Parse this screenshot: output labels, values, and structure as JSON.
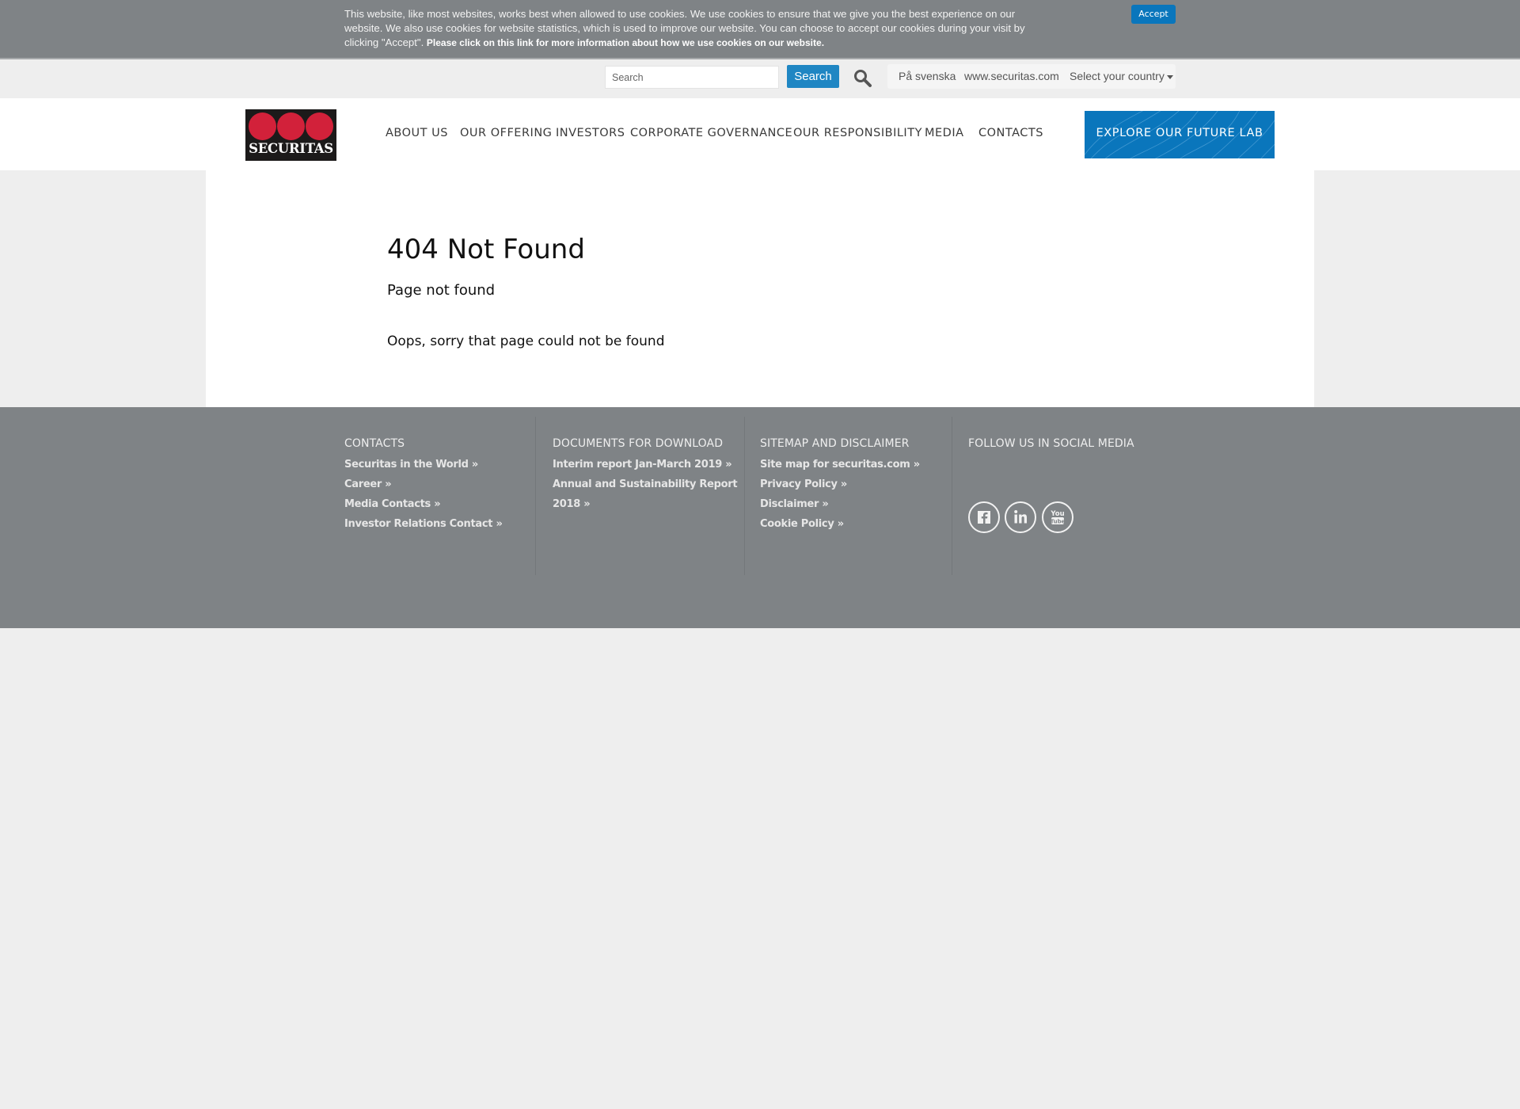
{
  "cookie_bar": {
    "text": "This website, like most websites, works best when allowed to use cookies. We use cookies to ensure that we give you the best experience on our website. We also use cookies for website statistics, which is used to improve our website. You can choose to accept our cookies during your visit by clicking \"Accept\".",
    "more_link": "Please click on this link for more information about how we use cookies on our website.",
    "accept_label": "Accept"
  },
  "utility": {
    "search_placeholder": "Search",
    "search_value": "",
    "search_button": "Search",
    "search_icon": "magnifier-icon",
    "language_link": "På svenska",
    "global_site_link": "www.securitas.com",
    "country_select": "Select your country"
  },
  "header": {
    "logo_text": "SECURITAS",
    "nav": [
      {
        "label": "ABOUT US"
      },
      {
        "label": "OUR OFFERING"
      },
      {
        "label": "INVESTORS"
      },
      {
        "label": "CORPORATE GOVERNANCE"
      },
      {
        "label": "OUR RESPONSIBILITY"
      },
      {
        "label": "MEDIA"
      },
      {
        "label": "CONTACTS"
      }
    ],
    "cta_label": "EXPLORE OUR FUTURE LAB"
  },
  "main": {
    "title": "404 Not Found",
    "subtitle": "Page not found",
    "message": "Oops, sorry that page could not be found"
  },
  "footer": {
    "columns": [
      {
        "heading": "CONTACTS",
        "links": [
          "Securitas in the World »",
          "Career »",
          "Media Contacts »",
          "Investor Relations Contact »"
        ]
      },
      {
        "heading": "DOCUMENTS FOR DOWNLOAD",
        "links": [
          "Interim report Jan-March 2019 »",
          "Annual and Sustainability Report 2018 »"
        ]
      },
      {
        "heading": "SITEMAP AND DISCLAIMER",
        "links": [
          "Site map for securitas.com »",
          "Privacy Policy »",
          "Disclaimer »",
          "Cookie Policy »"
        ]
      },
      {
        "heading": "FOLLOW US IN SOCIAL MEDIA",
        "social": [
          "facebook-icon",
          "linkedin-icon",
          "youtube-icon"
        ]
      }
    ]
  },
  "colors": {
    "brand_red": "#d2213a",
    "accent_blue": "#0a76bc",
    "footer_gray": "#7f8386",
    "page_bg": "#eeeeee"
  }
}
